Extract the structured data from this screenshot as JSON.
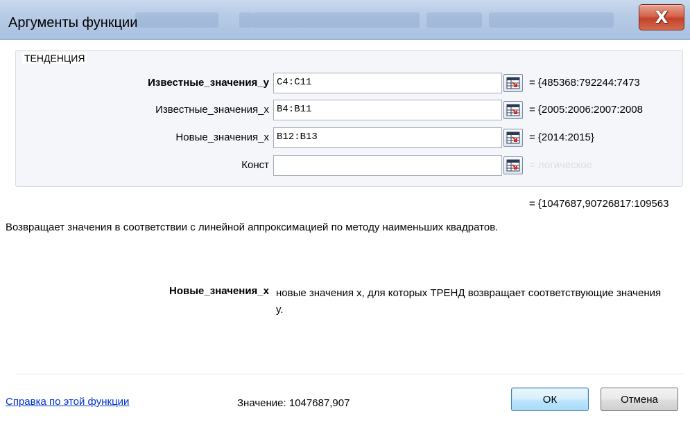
{
  "window": {
    "title": "Аргументы функции",
    "close_label": "X"
  },
  "function_group": {
    "name": "ТЕНДЕНЦИЯ",
    "args": [
      {
        "label": "Известные_значения_y",
        "value": "C4:C11",
        "result": "= {485368:792244:7473",
        "bold": true
      },
      {
        "label": "Известные_значения_x",
        "value": "B4:B11",
        "result": "= {2005:2006:2007:2008"
      },
      {
        "label": "Новые_значения_x",
        "value": "B12:B13",
        "result": "= {2014:2015}"
      },
      {
        "label": "Конст",
        "value": "",
        "result": "= логическое"
      }
    ]
  },
  "formula_result": "= {1047687,90726817:109563",
  "description": "Возвращает значения в соответствии с линейной аппроксимацией по методу наименьших квадратов.",
  "param_help": {
    "name": "Новые_значения_x",
    "text": "новые значения x, для которых ТРЕНД возвращает соответствующие значения y."
  },
  "footer": {
    "help_link": "Справка по этой функции",
    "value_label": "Значение: 1047687,907",
    "ok_label": "ОК",
    "cancel_label": "Отмена"
  },
  "icons": {
    "collapse_dialog": "range-select-icon"
  }
}
